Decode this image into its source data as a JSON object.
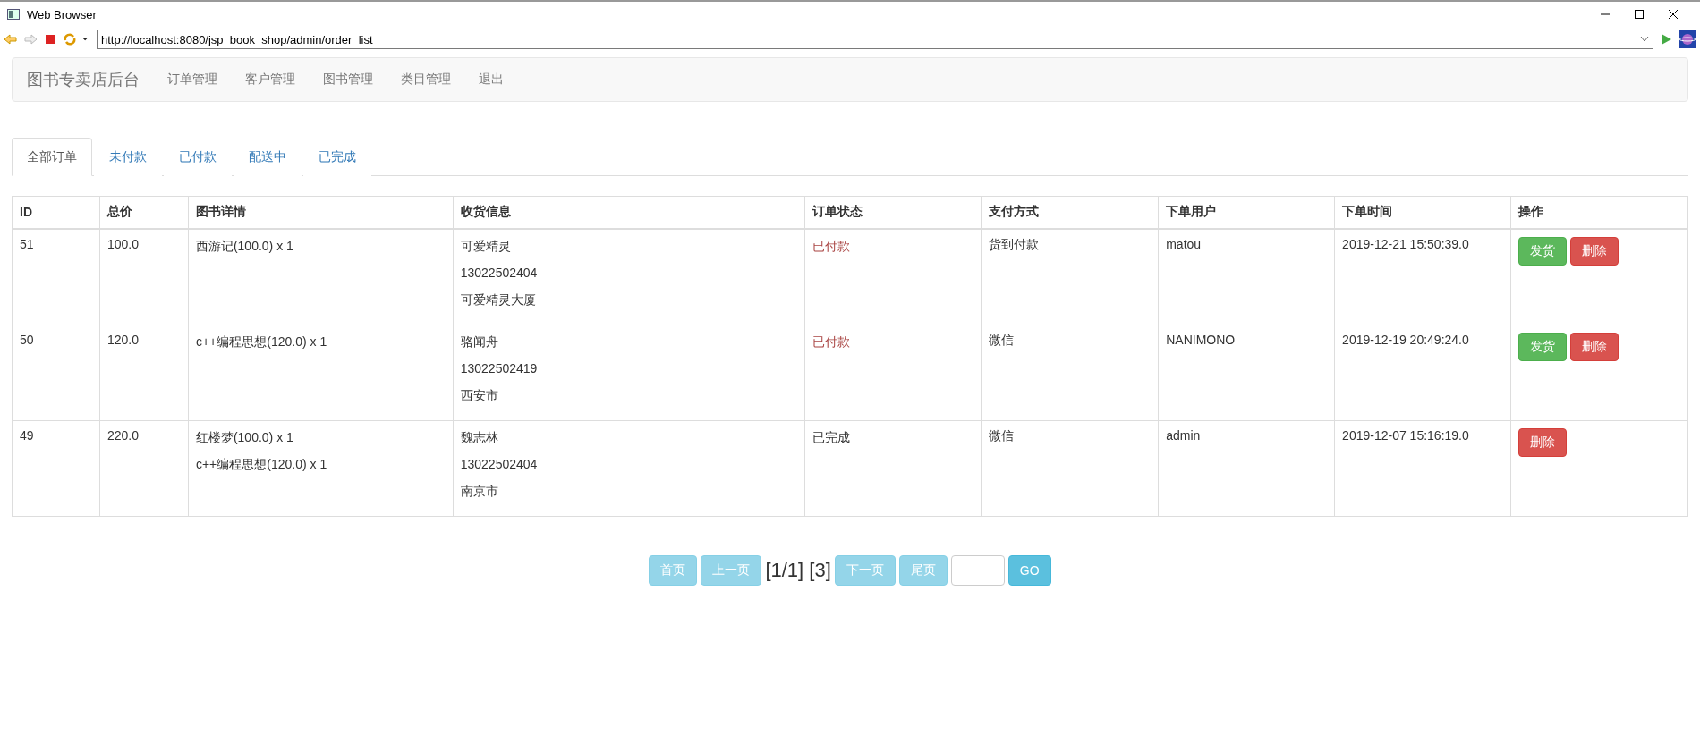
{
  "window": {
    "title": "Web Browser"
  },
  "address_bar": {
    "value": "http://localhost:8080/jsp_book_shop/admin/order_list"
  },
  "navbar": {
    "brand": "图书专卖店后台",
    "items": [
      "订单管理",
      "客户管理",
      "图书管理",
      "类目管理",
      "退出"
    ]
  },
  "tabs": [
    {
      "label": "全部订单",
      "selected": true
    },
    {
      "label": "未付款",
      "selected": false
    },
    {
      "label": "已付款",
      "selected": false
    },
    {
      "label": "配送中",
      "selected": false
    },
    {
      "label": "已完成",
      "selected": false
    }
  ],
  "table": {
    "columns": [
      "ID",
      "总价",
      "图书详情",
      "收货信息",
      "订单状态",
      "支付方式",
      "下单用户",
      "下单时间",
      "操作"
    ],
    "rows": [
      {
        "id": "51",
        "total": "100.0",
        "books": [
          "西游记(100.0) x 1"
        ],
        "receiver": [
          "可爱精灵",
          "13022502404",
          "可爱精灵大厦"
        ],
        "status": {
          "text": "已付款",
          "color": "#a94442"
        },
        "payment": "货到付款",
        "user": "matou",
        "time": "2019-12-21 15:50:39.0",
        "actions": [
          {
            "label": "发货",
            "kind": "ship"
          },
          {
            "label": "删除",
            "kind": "delete"
          }
        ]
      },
      {
        "id": "50",
        "total": "120.0",
        "books": [
          "c++编程思想(120.0) x 1"
        ],
        "receiver": [
          "骆闻舟",
          "13022502419",
          "西安市"
        ],
        "status": {
          "text": "已付款",
          "color": "#a94442"
        },
        "payment": "微信",
        "user": "NANIMONO",
        "time": "2019-12-19 20:49:24.0",
        "actions": [
          {
            "label": "发货",
            "kind": "ship"
          },
          {
            "label": "删除",
            "kind": "delete"
          }
        ]
      },
      {
        "id": "49",
        "total": "220.0",
        "books": [
          "红楼梦(100.0) x 1",
          "c++编程思想(120.0) x 1"
        ],
        "receiver": [
          "魏志林",
          "13022502404",
          "南京市"
        ],
        "status": {
          "text": "已完成",
          "color": "#333333"
        },
        "payment": "微信",
        "user": "admin",
        "time": "2019-12-07 15:16:19.0",
        "actions": [
          {
            "label": "删除",
            "kind": "delete"
          }
        ]
      }
    ]
  },
  "pagination": {
    "before": [
      {
        "label": "首页",
        "disabled": true
      },
      {
        "label": "上一页",
        "disabled": true
      }
    ],
    "info": "[1/1] [3]",
    "after": [
      {
        "label": "下一页",
        "disabled": true
      },
      {
        "label": "尾页",
        "disabled": true
      }
    ],
    "go": {
      "label": "GO",
      "disabled": false
    }
  }
}
